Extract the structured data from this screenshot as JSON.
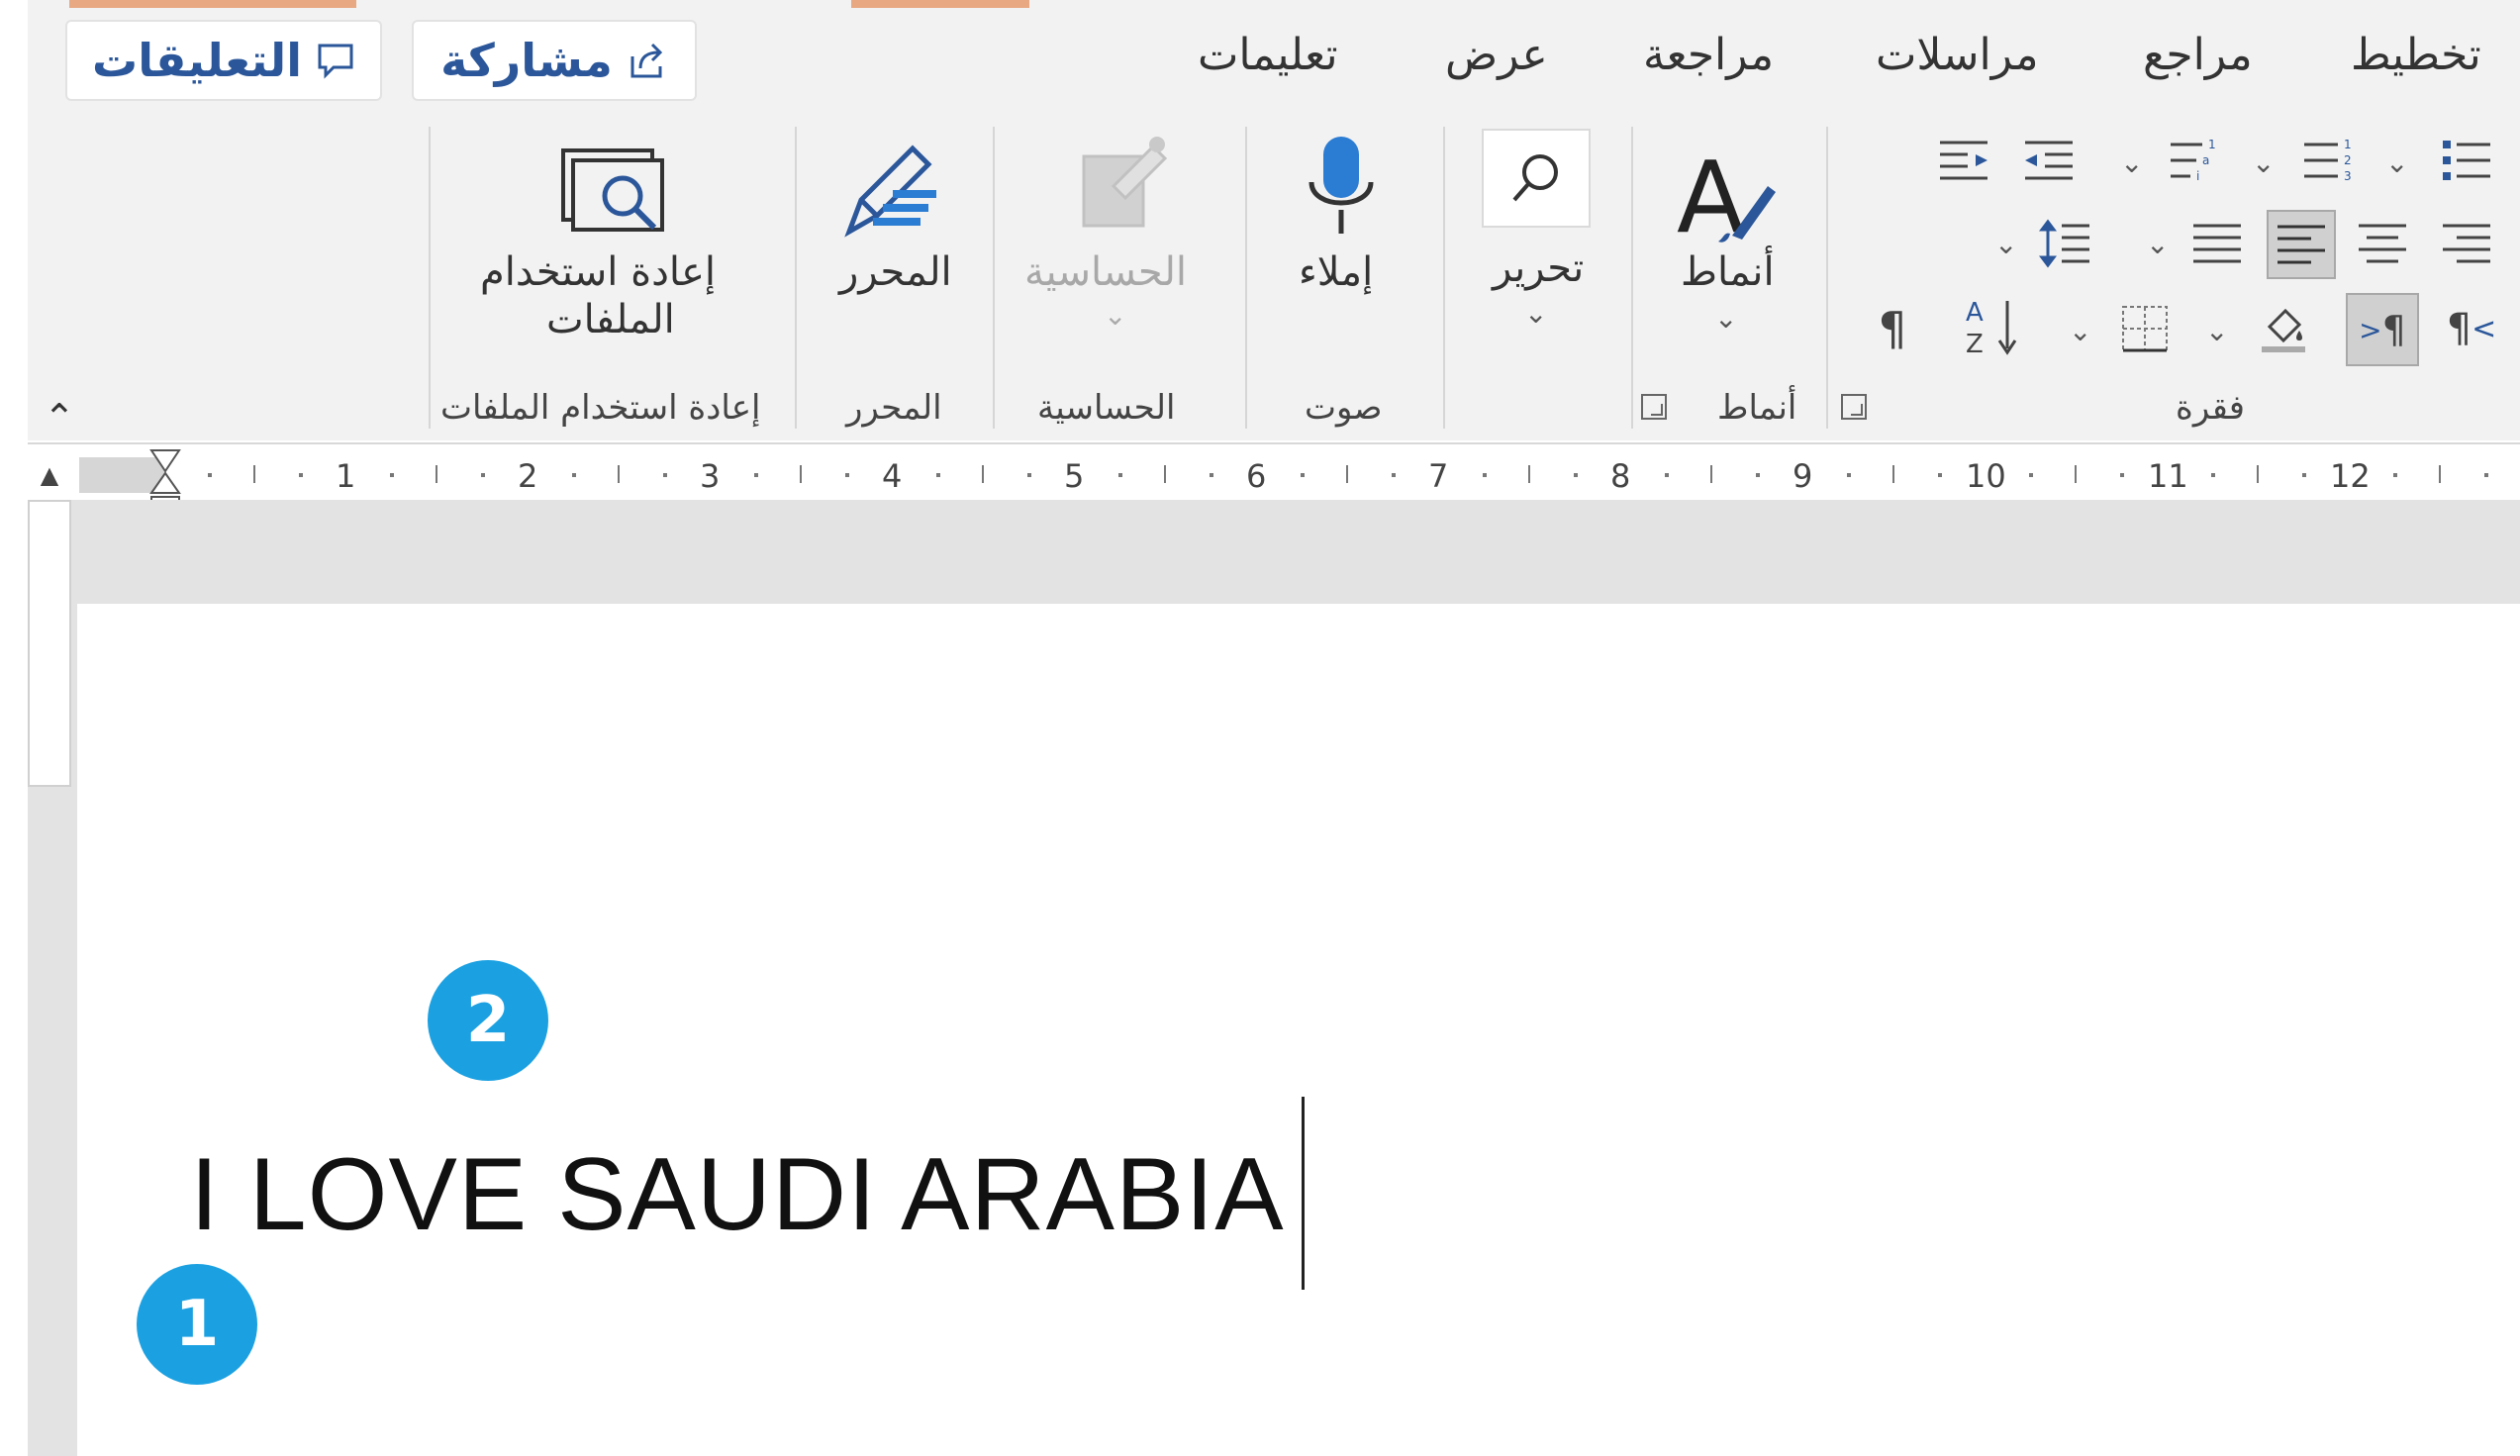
{
  "tabs": [
    "تخطيط",
    "مراجع",
    "مراسلات",
    "مراجعة",
    "عرض",
    "تعليمات"
  ],
  "top_buttons": {
    "share": "مشاركة",
    "comments": "التعليقات"
  },
  "groups": {
    "paragraph": "فقرة",
    "styles": "أنماط",
    "voice": "صوت",
    "sensitivity": "الحساسية",
    "editor": "المحرر",
    "reuse_files": "إعادة استخدام الملفات"
  },
  "commands": {
    "styles": "أنماط",
    "editing": "تحرير",
    "dictate": "إملاء",
    "sensitivity": "الحساسية",
    "editor": "المحرر",
    "reuse_files_line1": "إعادة استخدام",
    "reuse_files_line2": "الملفات"
  },
  "ruler_numbers": [
    "1",
    "2",
    "3",
    "4",
    "5",
    "6",
    "7",
    "8",
    "9",
    "10",
    "11",
    "12"
  ],
  "document": {
    "text": "I LOVE SAUDI ARABIA"
  },
  "callouts": {
    "one": "1",
    "two": "2"
  },
  "colors": {
    "accent": "#2b579a",
    "callout": "#1ba1e2",
    "ribbon_bg": "#f2f2f2"
  }
}
